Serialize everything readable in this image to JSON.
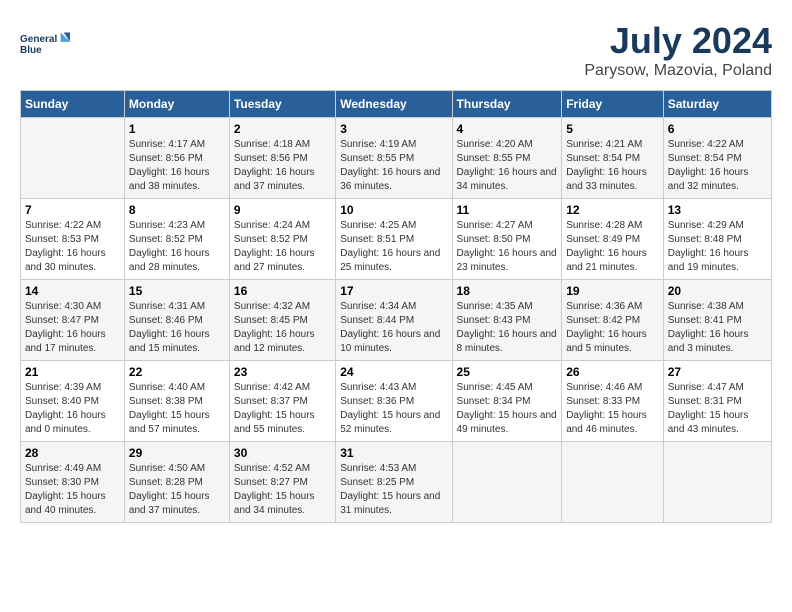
{
  "header": {
    "logo_line1": "General",
    "logo_line2": "Blue",
    "month_title": "July 2024",
    "subtitle": "Parysow, Mazovia, Poland"
  },
  "days_of_week": [
    "Sunday",
    "Monday",
    "Tuesday",
    "Wednesday",
    "Thursday",
    "Friday",
    "Saturday"
  ],
  "weeks": [
    [
      {
        "day": "",
        "sunrise": "",
        "sunset": "",
        "daylight": ""
      },
      {
        "day": "1",
        "sunrise": "Sunrise: 4:17 AM",
        "sunset": "Sunset: 8:56 PM",
        "daylight": "Daylight: 16 hours and 38 minutes."
      },
      {
        "day": "2",
        "sunrise": "Sunrise: 4:18 AM",
        "sunset": "Sunset: 8:56 PM",
        "daylight": "Daylight: 16 hours and 37 minutes."
      },
      {
        "day": "3",
        "sunrise": "Sunrise: 4:19 AM",
        "sunset": "Sunset: 8:55 PM",
        "daylight": "Daylight: 16 hours and 36 minutes."
      },
      {
        "day": "4",
        "sunrise": "Sunrise: 4:20 AM",
        "sunset": "Sunset: 8:55 PM",
        "daylight": "Daylight: 16 hours and 34 minutes."
      },
      {
        "day": "5",
        "sunrise": "Sunrise: 4:21 AM",
        "sunset": "Sunset: 8:54 PM",
        "daylight": "Daylight: 16 hours and 33 minutes."
      },
      {
        "day": "6",
        "sunrise": "Sunrise: 4:22 AM",
        "sunset": "Sunset: 8:54 PM",
        "daylight": "Daylight: 16 hours and 32 minutes."
      }
    ],
    [
      {
        "day": "7",
        "sunrise": "Sunrise: 4:22 AM",
        "sunset": "Sunset: 8:53 PM",
        "daylight": "Daylight: 16 hours and 30 minutes."
      },
      {
        "day": "8",
        "sunrise": "Sunrise: 4:23 AM",
        "sunset": "Sunset: 8:52 PM",
        "daylight": "Daylight: 16 hours and 28 minutes."
      },
      {
        "day": "9",
        "sunrise": "Sunrise: 4:24 AM",
        "sunset": "Sunset: 8:52 PM",
        "daylight": "Daylight: 16 hours and 27 minutes."
      },
      {
        "day": "10",
        "sunrise": "Sunrise: 4:25 AM",
        "sunset": "Sunset: 8:51 PM",
        "daylight": "Daylight: 16 hours and 25 minutes."
      },
      {
        "day": "11",
        "sunrise": "Sunrise: 4:27 AM",
        "sunset": "Sunset: 8:50 PM",
        "daylight": "Daylight: 16 hours and 23 minutes."
      },
      {
        "day": "12",
        "sunrise": "Sunrise: 4:28 AM",
        "sunset": "Sunset: 8:49 PM",
        "daylight": "Daylight: 16 hours and 21 minutes."
      },
      {
        "day": "13",
        "sunrise": "Sunrise: 4:29 AM",
        "sunset": "Sunset: 8:48 PM",
        "daylight": "Daylight: 16 hours and 19 minutes."
      }
    ],
    [
      {
        "day": "14",
        "sunrise": "Sunrise: 4:30 AM",
        "sunset": "Sunset: 8:47 PM",
        "daylight": "Daylight: 16 hours and 17 minutes."
      },
      {
        "day": "15",
        "sunrise": "Sunrise: 4:31 AM",
        "sunset": "Sunset: 8:46 PM",
        "daylight": "Daylight: 16 hours and 15 minutes."
      },
      {
        "day": "16",
        "sunrise": "Sunrise: 4:32 AM",
        "sunset": "Sunset: 8:45 PM",
        "daylight": "Daylight: 16 hours and 12 minutes."
      },
      {
        "day": "17",
        "sunrise": "Sunrise: 4:34 AM",
        "sunset": "Sunset: 8:44 PM",
        "daylight": "Daylight: 16 hours and 10 minutes."
      },
      {
        "day": "18",
        "sunrise": "Sunrise: 4:35 AM",
        "sunset": "Sunset: 8:43 PM",
        "daylight": "Daylight: 16 hours and 8 minutes."
      },
      {
        "day": "19",
        "sunrise": "Sunrise: 4:36 AM",
        "sunset": "Sunset: 8:42 PM",
        "daylight": "Daylight: 16 hours and 5 minutes."
      },
      {
        "day": "20",
        "sunrise": "Sunrise: 4:38 AM",
        "sunset": "Sunset: 8:41 PM",
        "daylight": "Daylight: 16 hours and 3 minutes."
      }
    ],
    [
      {
        "day": "21",
        "sunrise": "Sunrise: 4:39 AM",
        "sunset": "Sunset: 8:40 PM",
        "daylight": "Daylight: 16 hours and 0 minutes."
      },
      {
        "day": "22",
        "sunrise": "Sunrise: 4:40 AM",
        "sunset": "Sunset: 8:38 PM",
        "daylight": "Daylight: 15 hours and 57 minutes."
      },
      {
        "day": "23",
        "sunrise": "Sunrise: 4:42 AM",
        "sunset": "Sunset: 8:37 PM",
        "daylight": "Daylight: 15 hours and 55 minutes."
      },
      {
        "day": "24",
        "sunrise": "Sunrise: 4:43 AM",
        "sunset": "Sunset: 8:36 PM",
        "daylight": "Daylight: 15 hours and 52 minutes."
      },
      {
        "day": "25",
        "sunrise": "Sunrise: 4:45 AM",
        "sunset": "Sunset: 8:34 PM",
        "daylight": "Daylight: 15 hours and 49 minutes."
      },
      {
        "day": "26",
        "sunrise": "Sunrise: 4:46 AM",
        "sunset": "Sunset: 8:33 PM",
        "daylight": "Daylight: 15 hours and 46 minutes."
      },
      {
        "day": "27",
        "sunrise": "Sunrise: 4:47 AM",
        "sunset": "Sunset: 8:31 PM",
        "daylight": "Daylight: 15 hours and 43 minutes."
      }
    ],
    [
      {
        "day": "28",
        "sunrise": "Sunrise: 4:49 AM",
        "sunset": "Sunset: 8:30 PM",
        "daylight": "Daylight: 15 hours and 40 minutes."
      },
      {
        "day": "29",
        "sunrise": "Sunrise: 4:50 AM",
        "sunset": "Sunset: 8:28 PM",
        "daylight": "Daylight: 15 hours and 37 minutes."
      },
      {
        "day": "30",
        "sunrise": "Sunrise: 4:52 AM",
        "sunset": "Sunset: 8:27 PM",
        "daylight": "Daylight: 15 hours and 34 minutes."
      },
      {
        "day": "31",
        "sunrise": "Sunrise: 4:53 AM",
        "sunset": "Sunset: 8:25 PM",
        "daylight": "Daylight: 15 hours and 31 minutes."
      },
      {
        "day": "",
        "sunrise": "",
        "sunset": "",
        "daylight": ""
      },
      {
        "day": "",
        "sunrise": "",
        "sunset": "",
        "daylight": ""
      },
      {
        "day": "",
        "sunrise": "",
        "sunset": "",
        "daylight": ""
      }
    ]
  ]
}
